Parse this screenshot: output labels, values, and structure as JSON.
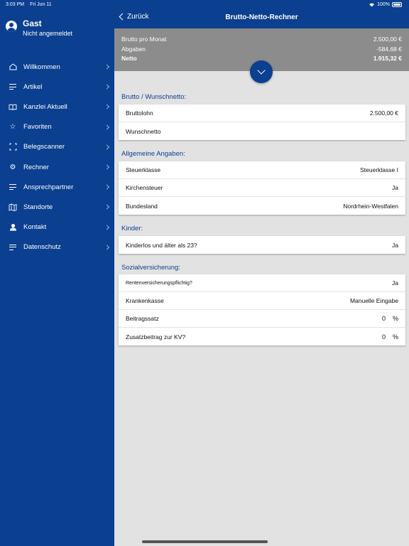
{
  "status": {
    "time": "3:03 PM",
    "date": "Fri Jun 11",
    "battery": "100%"
  },
  "user": {
    "name": "Gast",
    "status": "Nicht angemeldet"
  },
  "menu": [
    {
      "label": "Willkommen",
      "icon": "home-icon"
    },
    {
      "label": "Artikel",
      "icon": "lines-icon"
    },
    {
      "label": "Kanzlei Aktuell",
      "icon": "book-icon"
    },
    {
      "label": "Favoriten",
      "icon": "star-icon"
    },
    {
      "label": "Belegscanner",
      "icon": "scan-icon"
    },
    {
      "label": "Rechner",
      "icon": "gear-icon"
    },
    {
      "label": "Ansprechpartner",
      "icon": "lines-icon"
    },
    {
      "label": "Standorte",
      "icon": "map-icon"
    },
    {
      "label": "Kontakt",
      "icon": "person-icon"
    },
    {
      "label": "Datenschutz",
      "icon": "lines-icon"
    }
  ],
  "nav": {
    "back": "Zurück",
    "title": "Brutto-Netto-Rechner"
  },
  "summary": {
    "brutto_label": "Brutto pro Monat",
    "brutto_value": "2.500,00 €",
    "abgaben_label": "Abgaben",
    "abgaben_value": "-584,68 €",
    "netto_label": "Netto",
    "netto_value": "1.915,32 €"
  },
  "sections": {
    "s1": {
      "title": "Brutto / Wunschnetto:",
      "rows": [
        {
          "label": "Bruttolohn",
          "value": "2.500,00 €"
        },
        {
          "label": "Wunschnetto",
          "value": ""
        }
      ]
    },
    "s2": {
      "title": "Allgemeine Angaben:",
      "rows": [
        {
          "label": "Steuerklasse",
          "value": "Steuerklasse I"
        },
        {
          "label": "Kirchensteuer",
          "value": "Ja"
        },
        {
          "label": "Bundesland",
          "value": "Nordrhein-Westfalen"
        }
      ]
    },
    "s3": {
      "title": "Kinder:",
      "rows": [
        {
          "label": "Kinderlos und älter als 23?",
          "value": "Ja"
        }
      ]
    },
    "s4": {
      "title": "Sozialversicherung:",
      "rows": [
        {
          "label": "Rentenversicherungspflichtig?",
          "value": "Ja"
        },
        {
          "label": "Krankenkasse",
          "value": "Manuelle Eingabe"
        },
        {
          "label": "Beitragssatz",
          "value": "0",
          "unit": "%"
        },
        {
          "label": "Zusatzbeitrag zur KV?",
          "value": "0",
          "unit": "%"
        }
      ]
    }
  },
  "colors": {
    "primary": "#0b3f8f",
    "summary_bg": "#8c8c8c",
    "content_bg": "#e2e2e2"
  }
}
